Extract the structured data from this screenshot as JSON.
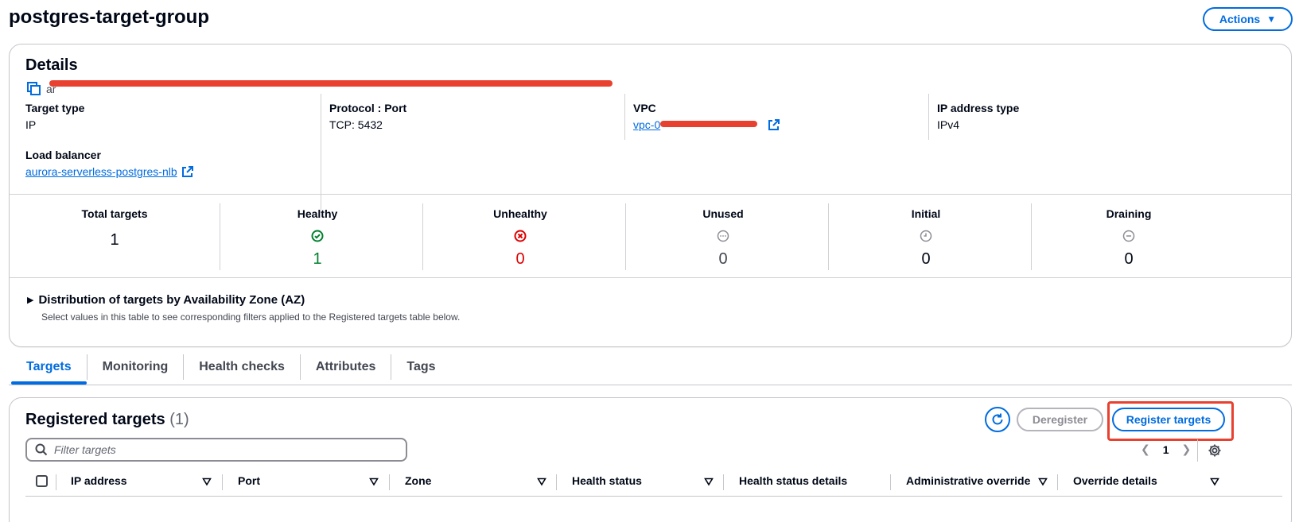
{
  "page": {
    "title": "postgres-target-group",
    "actions_label": "Actions"
  },
  "details": {
    "heading": "Details",
    "arn_prefix": "ar",
    "target_type_label": "Target type",
    "target_type_value": "IP",
    "protocol_port_label": "Protocol : Port",
    "protocol_port_value": "TCP: 5432",
    "vpc_label": "VPC",
    "vpc_value": "vpc-0",
    "ip_type_label": "IP address type",
    "ip_type_value": "IPv4",
    "lb_label": "Load balancer",
    "lb_value": "aurora-serverless-postgres-nlb"
  },
  "stats": [
    {
      "label": "Total targets",
      "value": "1",
      "icon": "none",
      "color": "#000716"
    },
    {
      "label": "Healthy",
      "value": "1",
      "icon": "check-circle-icon",
      "color": "#00802f"
    },
    {
      "label": "Unhealthy",
      "value": "0",
      "icon": "x-circle-icon",
      "color": "#db0000"
    },
    {
      "label": "Unused",
      "value": "0",
      "icon": "ellipsis-circle-icon",
      "color": "#424650"
    },
    {
      "label": "Initial",
      "value": "0",
      "icon": "clock-icon",
      "color": "#000716"
    },
    {
      "label": "Draining",
      "value": "0",
      "icon": "minus-circle-icon",
      "color": "#000716"
    }
  ],
  "distribution": {
    "title": "Distribution of targets by Availability Zone (AZ)",
    "description": "Select values in this table to see corresponding filters applied to the Registered targets table below."
  },
  "tabs": [
    {
      "label": "Targets",
      "active": true
    },
    {
      "label": "Monitoring",
      "active": false
    },
    {
      "label": "Health checks",
      "active": false
    },
    {
      "label": "Attributes",
      "active": false
    },
    {
      "label": "Tags",
      "active": false
    }
  ],
  "registered": {
    "title": "Registered targets",
    "count": "(1)",
    "deregister_label": "Deregister",
    "register_label": "Register targets",
    "filter_placeholder": "Filter targets",
    "page_number": "1",
    "columns": [
      "IP address",
      "Port",
      "Zone",
      "Health status",
      "Health status details",
      "Administrative override",
      "Override details"
    ]
  }
}
